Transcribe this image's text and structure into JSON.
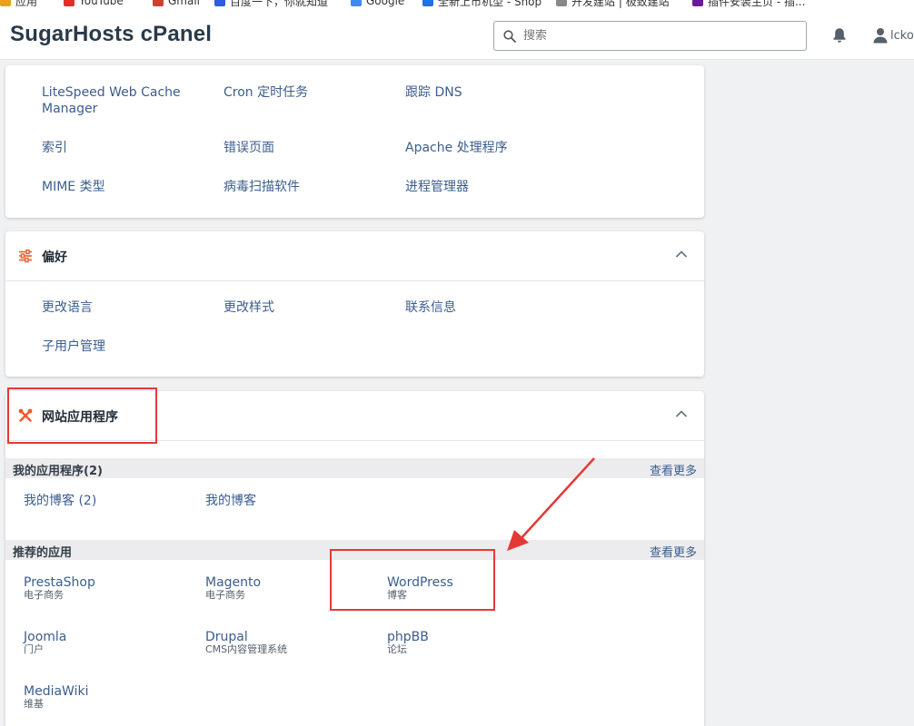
{
  "bookmarks": [
    {
      "label": "应用",
      "color": "#e8a21a"
    },
    {
      "label": "YouTube",
      "color": "#e52d27"
    },
    {
      "label": "Gmail",
      "color": "#d23f31"
    },
    {
      "label": "百度一下，你就知道",
      "color": "#2f5be5"
    },
    {
      "label": "Google",
      "color": "#4285f4"
    },
    {
      "label": "全新上市机型 - Shop",
      "color": "#1a73e8"
    },
    {
      "label": "开发建站 | 极致建站",
      "color": "#555555"
    },
    {
      "label": "插件安装主页 - 插...",
      "color": "#6a1b9a"
    }
  ],
  "header": {
    "brand": "SugarHosts cPanel",
    "search_placeholder": "搜索",
    "user": "lckov"
  },
  "advanced": {
    "items": [
      "LiteSpeed Web Cache Manager",
      "Cron 定时任务",
      "跟踪 DNS",
      "索引",
      "错误页面",
      "Apache 处理程序",
      "MIME 类型",
      "病毒扫描软件",
      "进程管理器"
    ]
  },
  "preferences": {
    "title": "偏好",
    "items": [
      "更改语言",
      "更改样式",
      "联系信息",
      "子用户管理"
    ]
  },
  "webapps": {
    "title": "网站应用程序",
    "my_apps": {
      "title": "我的应用程序(2)",
      "more": "查看更多",
      "items": [
        "我的博客 (2)",
        "我的博客"
      ]
    },
    "featured": {
      "title": "推荐的应用",
      "more": "查看更多",
      "items": [
        {
          "name": "PrestaShop",
          "category": "电子商务"
        },
        {
          "name": "Magento",
          "category": "电子商务"
        },
        {
          "name": "WordPress",
          "category": "博客"
        },
        {
          "name": "Joomla",
          "category": "门户"
        },
        {
          "name": "Drupal",
          "category": "CMS内容管理系统"
        },
        {
          "name": "phpBB",
          "category": "论坛"
        },
        {
          "name": "MediaWiki",
          "category": "维基"
        }
      ]
    }
  },
  "colors": {
    "accent_link": "#3b5d8f",
    "section_icon": "#f0592a",
    "annotation": "#e53935"
  }
}
